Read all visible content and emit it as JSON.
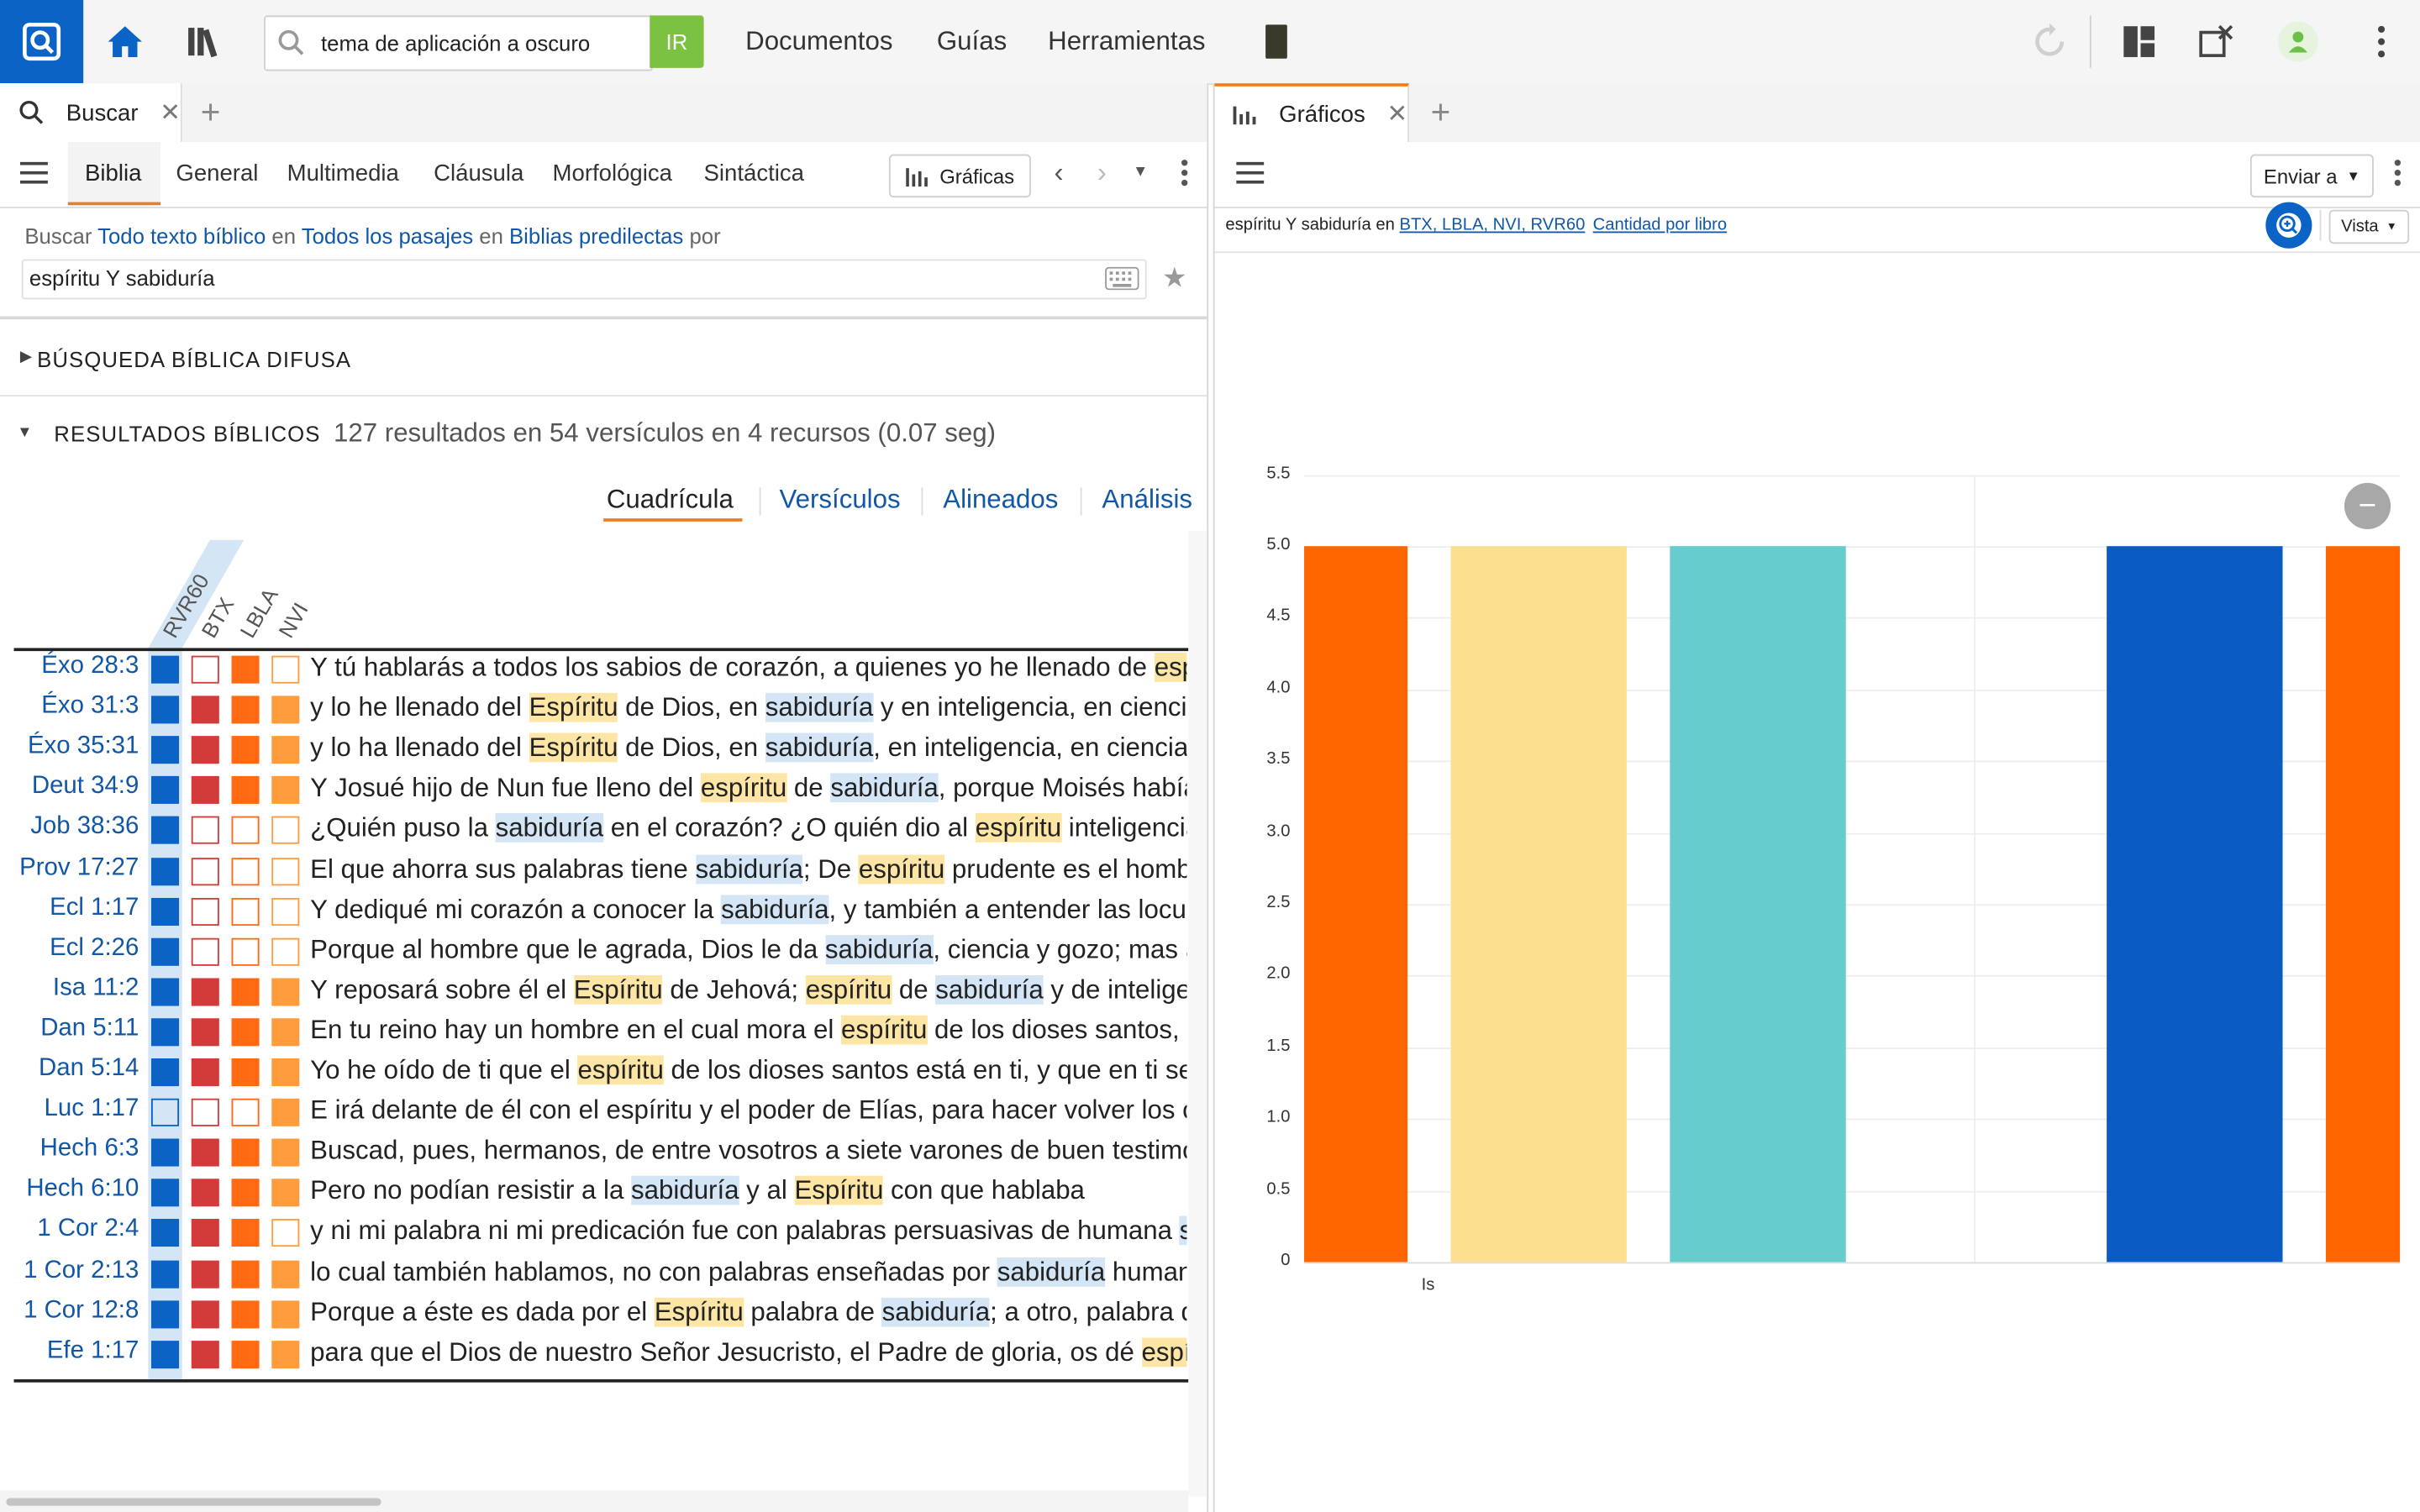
{
  "topbar": {
    "search_value": "tema de aplicación a oscuro",
    "go_label": "IR",
    "nav": [
      "Documentos",
      "Guías",
      "Herramientas"
    ]
  },
  "left": {
    "tab_title": "Buscar",
    "subtabs": [
      "Biblia",
      "General",
      "Multimedia",
      "Cláusula",
      "Morfológica",
      "Sintáctica"
    ],
    "graficas_btn": "Gráficas",
    "query_line": {
      "buscar": "Buscar",
      "scope1": "Todo texto bíblico",
      "en1": "en",
      "scope2": "Todos los pasajes",
      "en2": "en",
      "scope3": "Biblias predilectas",
      "por": "por"
    },
    "query": "espíritu Y sabiduría",
    "fuzzy_title": "BÚSQUEDA BÍBLICA DIFUSA",
    "results_title": "RESULTADOS BÍBLICOS",
    "results_summary": "127 resultados en 54 versículos en 4 recursos (0.07 seg)",
    "view_tabs": [
      "Cuadrícula",
      "Versículos",
      "Alineados",
      "Análisis"
    ],
    "columns": [
      "RVR60",
      "BTX",
      "LBLA",
      "NVI"
    ],
    "rows": [
      {
        "ref": "Éxo 28:3",
        "c": [
          1,
          0,
          1,
          0
        ],
        "segs": [
          [
            "Y tú hablarás a todos los sabios de corazón, a quienes yo he llenado de ",
            ""
          ],
          [
            "espíritu",
            "y"
          ]
        ]
      },
      {
        "ref": "Éxo 31:3",
        "c": [
          1,
          1,
          1,
          1
        ],
        "segs": [
          [
            "y lo he llenado del ",
            ""
          ],
          [
            "Espíritu",
            "y"
          ],
          [
            " de Dios, en ",
            ""
          ],
          [
            "sabiduría",
            "b"
          ],
          [
            " y en inteligencia, en ciencia y en todo arte",
            ""
          ]
        ]
      },
      {
        "ref": "Éxo 35:31",
        "c": [
          1,
          1,
          1,
          1
        ],
        "segs": [
          [
            "y lo ha llenado del ",
            ""
          ],
          [
            "Espíritu",
            "y"
          ],
          [
            " de Dios, en ",
            ""
          ],
          [
            "sabiduría",
            "b"
          ],
          [
            ", en inteligencia, en ciencia y en todo arte",
            ""
          ]
        ]
      },
      {
        "ref": "Deut 34:9",
        "c": [
          1,
          1,
          1,
          1
        ],
        "segs": [
          [
            "Y Josué hijo de Nun fue lleno del ",
            ""
          ],
          [
            "espíritu",
            "y"
          ],
          [
            " de ",
            ""
          ],
          [
            "sabiduría",
            "b"
          ],
          [
            ", porque Moisés había puesto sus manos",
            ""
          ]
        ]
      },
      {
        "ref": "Job 38:36",
        "c": [
          1,
          0,
          0,
          0
        ],
        "segs": [
          [
            "¿Quién puso la ",
            ""
          ],
          [
            "sabiduría",
            "b"
          ],
          [
            " en el corazón? ¿O quién dio al ",
            ""
          ],
          [
            "espíritu",
            "y"
          ],
          [
            " inteligencia?",
            ""
          ]
        ]
      },
      {
        "ref": "Prov 17:27",
        "c": [
          1,
          0,
          0,
          0
        ],
        "segs": [
          [
            "El que ahorra sus palabras tiene ",
            ""
          ],
          [
            "sabiduría",
            "b"
          ],
          [
            "; De ",
            ""
          ],
          [
            "espíritu",
            "y"
          ],
          [
            " prudente es el hombre entendido",
            ""
          ]
        ]
      },
      {
        "ref": "Ecl 1:17",
        "c": [
          1,
          0,
          0,
          0
        ],
        "segs": [
          [
            "Y dediqué mi corazón a conocer la ",
            ""
          ],
          [
            "sabiduría",
            "b"
          ],
          [
            ", y también a entender las locuras y los desvaríos",
            ""
          ]
        ]
      },
      {
        "ref": "Ecl 2:26",
        "c": [
          1,
          0,
          0,
          0
        ],
        "segs": [
          [
            "Porque al hombre que le agrada, Dios le da ",
            ""
          ],
          [
            "sabiduría",
            "b"
          ],
          [
            ", ciencia y gozo; mas al pecador da el trabajo",
            ""
          ]
        ]
      },
      {
        "ref": "Isa 11:2",
        "c": [
          1,
          1,
          1,
          1
        ],
        "segs": [
          [
            "Y reposará sobre él el ",
            ""
          ],
          [
            "Espíritu",
            "y"
          ],
          [
            " de Jehová; ",
            ""
          ],
          [
            "espíritu",
            "y"
          ],
          [
            " de ",
            ""
          ],
          [
            "sabiduría",
            "b"
          ],
          [
            " y de inteligencia",
            ""
          ]
        ]
      },
      {
        "ref": "Dan 5:11",
        "c": [
          1,
          1,
          1,
          1
        ],
        "segs": [
          [
            "En tu reino hay un hombre en el cual mora el ",
            ""
          ],
          [
            "espíritu",
            "y"
          ],
          [
            " de los dioses santos, y en los días",
            ""
          ]
        ]
      },
      {
        "ref": "Dan 5:14",
        "c": [
          1,
          1,
          1,
          1
        ],
        "segs": [
          [
            "Yo he oído de ti que el ",
            ""
          ],
          [
            "espíritu",
            "y"
          ],
          [
            " de los dioses santos está en ti, y que en ti se halló luz",
            ""
          ]
        ]
      },
      {
        "ref": "Luc 1:17",
        "c": [
          2,
          0,
          0,
          1
        ],
        "segs": [
          [
            "E irá delante de él con el espíritu y el poder de Elías, para hacer volver los corazones",
            ""
          ]
        ]
      },
      {
        "ref": "Hech 6:3",
        "c": [
          1,
          1,
          1,
          1
        ],
        "segs": [
          [
            "Buscad, pues, hermanos, de entre vosotros a siete varones de buen testimonio",
            ""
          ]
        ]
      },
      {
        "ref": "Hech 6:10",
        "c": [
          1,
          1,
          1,
          1
        ],
        "segs": [
          [
            "Pero no podían resistir a la ",
            ""
          ],
          [
            "sabiduría",
            "b"
          ],
          [
            " y al ",
            ""
          ],
          [
            "Espíritu",
            "y"
          ],
          [
            " con que hablaba",
            ""
          ]
        ]
      },
      {
        "ref": "1 Cor 2:4",
        "c": [
          1,
          1,
          1,
          0
        ],
        "segs": [
          [
            "y ni mi palabra ni mi predicación fue con palabras persuasivas de humana ",
            ""
          ],
          [
            "sabiduría",
            "b"
          ]
        ]
      },
      {
        "ref": "1 Cor 2:13",
        "c": [
          1,
          1,
          1,
          1
        ],
        "segs": [
          [
            "lo cual también hablamos, no con palabras enseñadas por ",
            ""
          ],
          [
            "sabiduría",
            "b"
          ],
          [
            " humana, sino con las que enseña",
            ""
          ]
        ]
      },
      {
        "ref": "1 Cor 12:8",
        "c": [
          1,
          1,
          1,
          1
        ],
        "segs": [
          [
            "Porque a éste es dada por el ",
            ""
          ],
          [
            "Espíritu",
            "y"
          ],
          [
            " palabra de ",
            ""
          ],
          [
            "sabiduría",
            "b"
          ],
          [
            "; a otro, palabra de ciencia",
            ""
          ]
        ]
      },
      {
        "ref": "Efe 1:17",
        "c": [
          1,
          1,
          1,
          1
        ],
        "segs": [
          [
            "para que el Dios de nuestro Señor Jesucristo, el Padre de gloria, os dé ",
            ""
          ],
          [
            "espíritu",
            "y"
          ]
        ]
      }
    ]
  },
  "right": {
    "tab_title": "Gráficos",
    "send_btn": "Enviar a",
    "vista_btn": "Vista",
    "subtitle_prefix": "espíritu Y sabiduría",
    "subtitle_en": "en",
    "subtitle_link1": "BTX, LBLA, NVI, RVR60",
    "subtitle_link2": "Cantidad por libro"
  },
  "colors": {
    "rvr60": "#0b63c6",
    "btx": "#d33a3a",
    "lbla": "#ff6a13",
    "nvi": "#ff9c3d",
    "accent": "#f07c1e",
    "link": "#1257a6"
  },
  "chart_data": {
    "type": "bar",
    "categories": [
      "Is"
    ],
    "series": [
      {
        "values": [
          5
        ]
      },
      {
        "values": [
          5
        ]
      },
      {
        "values": [
          5
        ]
      },
      {
        "values": [
          5
        ]
      },
      {
        "values": [
          5
        ]
      }
    ],
    "series_colors": [
      "#ff6600",
      "#fde08f",
      "#66cccc",
      "#0a5cc4",
      "#ff6600"
    ],
    "yticks": [
      "0",
      "0.5",
      "1.0",
      "1.5",
      "2.0",
      "2.5",
      "3.0",
      "3.5",
      "4.0",
      "4.5",
      "5.0",
      "5.5"
    ],
    "ylim": [
      0,
      5.5
    ]
  }
}
